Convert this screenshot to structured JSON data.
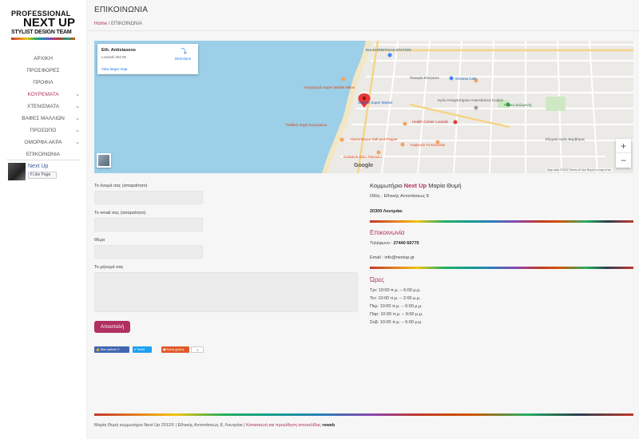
{
  "logo": {
    "line1": "PROFESSIONAL",
    "line2": "NEXT UP",
    "line3": "STYLIST DESIGN TEAM"
  },
  "menu": [
    {
      "label": "ΑΡΧΙΚΗ",
      "active": false,
      "has_sub": false
    },
    {
      "label": "ΠΡΟΣΦΟΡΕΣ",
      "active": false,
      "has_sub": false
    },
    {
      "label": "ΠΡΟΦΙΛ",
      "active": false,
      "has_sub": false
    },
    {
      "label": "ΚΟΥΡΕΜΑΤΑ",
      "active": true,
      "has_sub": true
    },
    {
      "label": "ΧΤΕΝΙΣΜΑΤΑ",
      "active": false,
      "has_sub": true
    },
    {
      "label": "ΒΑΦΕΣ ΜΑΛΛΙΩΝ",
      "active": false,
      "has_sub": true
    },
    {
      "label": "ΠΡΟΣΩΠΟ",
      "active": false,
      "has_sub": true
    },
    {
      "label": "ΟΜΟΡΦΑ ΑΚΡΑ",
      "active": false,
      "has_sub": true
    },
    {
      "label": "ΕΠΙΚΟΙΝΩΝΙΑ",
      "active": false,
      "has_sub": false
    }
  ],
  "facebook": {
    "page_name": "Next Up",
    "like_label": "Like Page"
  },
  "header": {
    "title": "ΕΠΙΚΟΙΝΩΝΙΑ",
    "breadcrumb_home": "Home",
    "breadcrumb_sep": " / ",
    "breadcrumb_current": "ΕΠΙΚΟΙΝΩΝΙΑ"
  },
  "map": {
    "card_title": "Eth. Antistaseos",
    "card_sub": "Loutraki 203 00",
    "card_link": "View larger map",
    "directions": "Directions",
    "google": "Google",
    "footer": "Map data ©2022   Terms of Use   Report a map error",
    "zoom_in": "+",
    "zoom_out": "−",
    "labels": {
      "korinthias": "Bus KORINTHIAS STATION",
      "panagia": "Παναγία Ελεήσατε",
      "gerania": "Gerania Cafe",
      "galinos": "Galinos Super Market",
      "nikos": "Υπεραγορά Super Market Nikos",
      "paidiki": "Παιδική Χαρά Λουτρακίου",
      "hiero": "Ιερόν Ησυχαστήριον Αναστάσεως Κυρίου",
      "parko": "Πάρκο Δεξαμενής",
      "health": "Health Center Loutraki",
      "pizza": "Pizza Ristorante",
      "alatopiperi": "Αλατοπίπερο Salt and Pepper",
      "kafeneio": "Καφενείο Το Κουτούκι",
      "gelateria": "Gelateria Dolci Passioni",
      "exohiko": "Εξοχικό Αγίας Βαρβάρας",
      "cafe_c": "Cafe C"
    }
  },
  "form": {
    "name_label": "Το όνομά σας (απαραίτητο)",
    "email_label": "Το email σας (απαραίτητο)",
    "subject_label": "Θέμα",
    "message_label": "Το μήνυμά σας",
    "submit": "Αποστολή",
    "share_fb": "Μου αρέσει! 2",
    "share_tw": "Tweet",
    "share_gp": "Κοινή χρήση",
    "share_count": "1"
  },
  "info": {
    "title_pre": "Κομμωτήριο ",
    "title_brand": "Next Up",
    "title_post": " Μαρία Θυμή",
    "address": "Οδός : Εθνικής Αντιστάσεως 8",
    "postcode": "20300 Λουτράκι",
    "contact_head": "Επικοινωνία",
    "phone_label": "Τηλέφωνο : ",
    "phone": "27440 66770",
    "email_label": "Email : ",
    "email": "info@nextup.gr",
    "hours_head": "Ώρες",
    "hours": [
      "Τρι: 10:00 π.μ. – 6:00 μ.μ.",
      "Τετ: 10:00 π.μ. – 2:00 μ.μ.",
      "Πεμ: 10:00 π.μ. – 6:00 μ.μ.",
      "Παρ: 10:00 π.μ. – 9:00 μ.μ.",
      "Σαβ: 10:00 π.μ. – 6:00 μ.μ."
    ]
  },
  "footer": {
    "text": "Μαρία Θυμή κομμωτήριο Next Up 2012© | Εθνικής Αντιστάσεως 8, Λουτράκι | ",
    "link": "Κατασκευή και προώθηση ιστοσελίδας ",
    "brand": "reweb"
  },
  "colors": {
    "accent": "#b03060",
    "background": "#f6f6f6"
  }
}
